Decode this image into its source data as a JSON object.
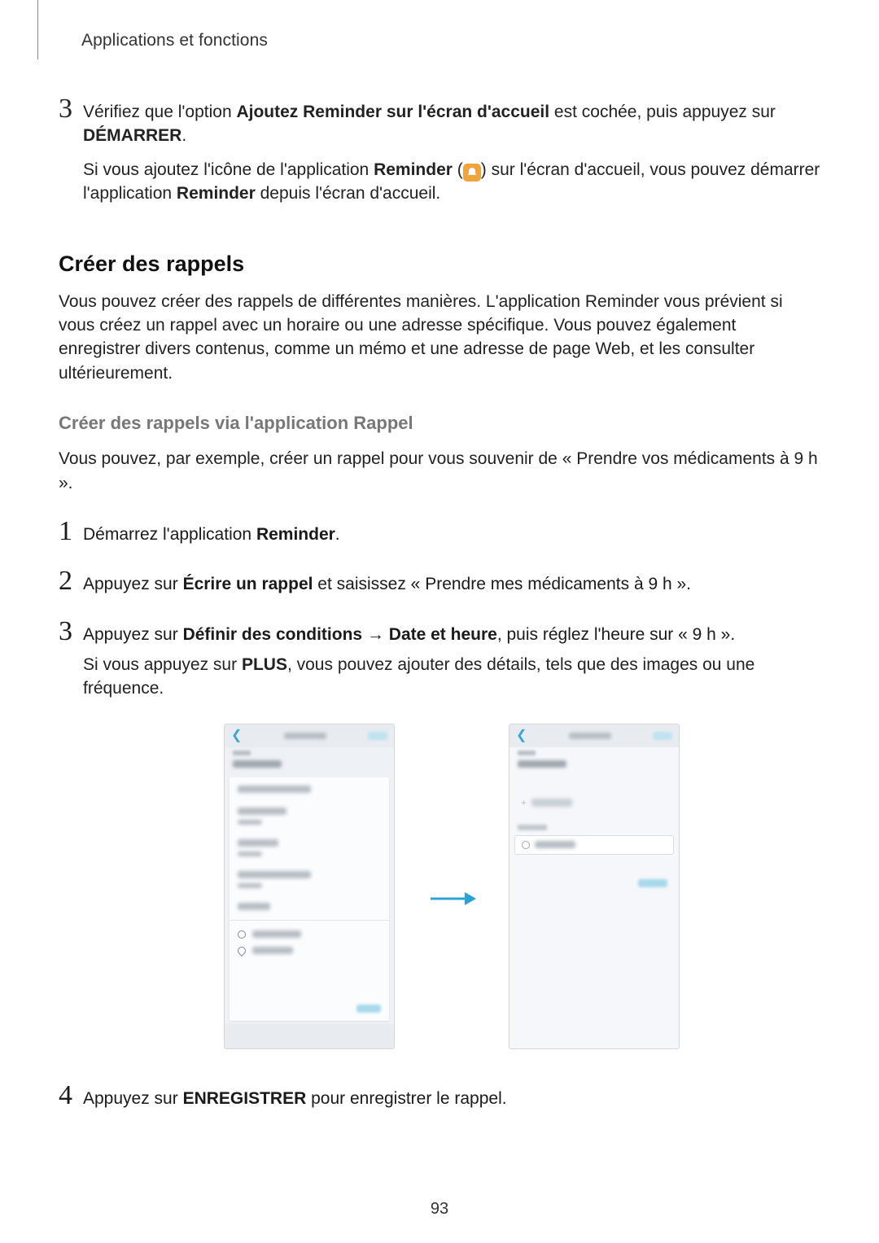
{
  "header": "Applications et fonctions",
  "step3": {
    "num": "3",
    "t1": "Vérifiez que l'option ",
    "b1": "Ajoutez Reminder sur l'écran d'accueil",
    "t2": " est cochée, puis appuyez sur ",
    "b2": "DÉMARRER",
    "t3": ".",
    "p1a": "Si vous ajoutez l'icône de l'application ",
    "p1b": "Reminder",
    "p1c": " (",
    "p1d": ") sur l'écran d'accueil, vous pouvez démarrer l'application ",
    "p1e": "Reminder",
    "p1f": " depuis l'écran d'accueil."
  },
  "section": "Créer des rappels",
  "para1": "Vous pouvez créer des rappels de différentes manières. L'application Reminder vous prévient si vous créez un rappel avec un horaire ou une adresse spécifique. Vous pouvez également enregistrer divers contenus, comme un mémo et une adresse de page Web, et les consulter ultérieurement.",
  "subhead": "Créer des rappels via l'application Rappel",
  "para2": "Vous pouvez, par exemple, créer un rappel pour vous souvenir de « Prendre vos médicaments à 9 h ».",
  "s1": {
    "num": "1",
    "t1": "Démarrez l'application ",
    "b1": "Reminder",
    "t2": "."
  },
  "s2": {
    "num": "2",
    "t1": "Appuyez sur ",
    "b1": "Écrire un rappel",
    "t2": " et saisissez « Prendre mes médicaments à 9 h »."
  },
  "s3": {
    "num": "3",
    "t1": "Appuyez sur ",
    "b1": "Définir des conditions",
    "arrow": " → ",
    "b2": "Date et heure",
    "t2": ", puis réglez l'heure sur « 9 h ».",
    "p1": "Si vous appuyez sur ",
    "pb": "PLUS",
    "p2": ", vous pouvez ajouter des détails, tels que des images ou une fréquence."
  },
  "s4": {
    "num": "4",
    "t1": "Appuyez sur ",
    "b1": "ENREGISTRER",
    "t2": " pour enregistrer le rappel."
  },
  "page_number": "93"
}
